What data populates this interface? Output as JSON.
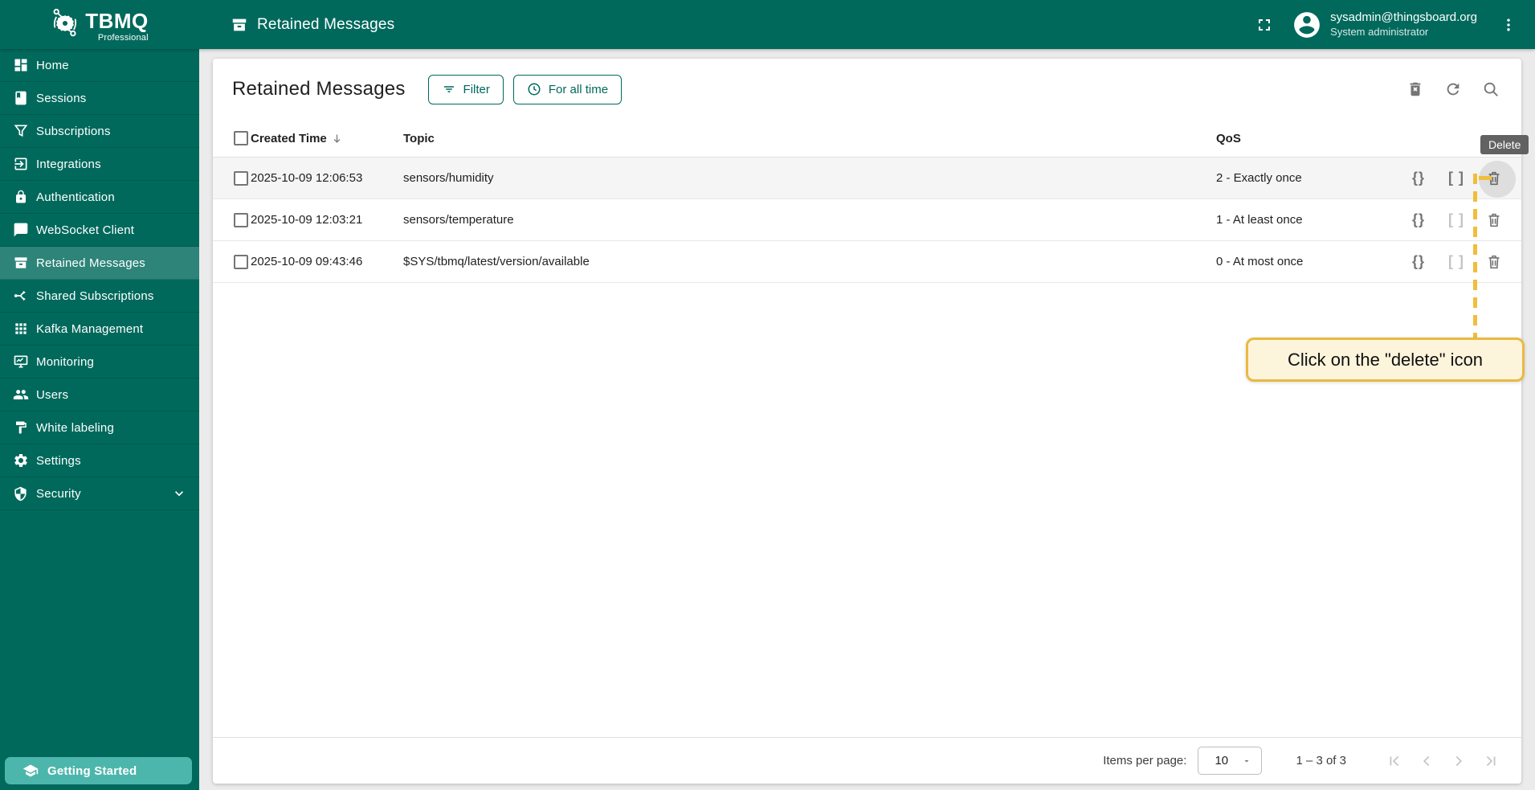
{
  "brand": {
    "name": "TBMQ",
    "subtitle": "Professional"
  },
  "header": {
    "title": "Retained Messages",
    "user_email": "sysadmin@thingsboard.org",
    "user_role": "System administrator"
  },
  "sidebar": {
    "items": [
      {
        "label": "Home",
        "icon": "dashboard-icon"
      },
      {
        "label": "Sessions",
        "icon": "book-icon"
      },
      {
        "label": "Subscriptions",
        "icon": "funnel-icon"
      },
      {
        "label": "Integrations",
        "icon": "exit-to-app-icon"
      },
      {
        "label": "Authentication",
        "icon": "lock-icon"
      },
      {
        "label": "WebSocket Client",
        "icon": "chat-icon"
      },
      {
        "label": "Retained Messages",
        "icon": "archive-icon"
      },
      {
        "label": "Shared Subscriptions",
        "icon": "split-icon"
      },
      {
        "label": "Kafka Management",
        "icon": "apps-grid-icon"
      },
      {
        "label": "Monitoring",
        "icon": "monitor-icon"
      },
      {
        "label": "Users",
        "icon": "people-icon"
      },
      {
        "label": "White labeling",
        "icon": "paint-roller-icon"
      },
      {
        "label": "Settings",
        "icon": "gear-icon"
      },
      {
        "label": "Security",
        "icon": "shield-icon"
      }
    ],
    "getting_started": "Getting Started"
  },
  "page": {
    "title": "Retained Messages",
    "filter_button": "Filter",
    "time_button": "For all time",
    "tooltip": "Delete",
    "annotation": "Click on the \"delete\" icon"
  },
  "table": {
    "columns": {
      "created": "Created Time",
      "topic": "Topic",
      "qos": "QoS"
    },
    "rows": [
      {
        "created": "2025-10-09 12:06:53",
        "topic": "sensors/humidity",
        "qos": "2 - Exactly once"
      },
      {
        "created": "2025-10-09 12:03:21",
        "topic": "sensors/temperature",
        "qos": "1 - At least once"
      },
      {
        "created": "2025-10-09 09:43:46",
        "topic": "$SYS/tbmq/latest/version/available",
        "qos": "0 - At most once"
      }
    ]
  },
  "icons": {
    "braces": "{}",
    "brackets": "[ ]"
  },
  "pagination": {
    "items_per_page_label": "Items per page:",
    "items_per_page": "10",
    "range": "1 – 3 of 3"
  },
  "colors": {
    "primary_teal": "#00695C",
    "selected_overlay": "rgba(255,255,255,0.18)",
    "getting_started_teal": "#4DB6AC",
    "annotation_amber": "#EFBE3D",
    "annotation_bg": "#FDF4DC",
    "tooltip_gray": "#5A5A5A",
    "row_highlight": "#F5F5F5"
  }
}
